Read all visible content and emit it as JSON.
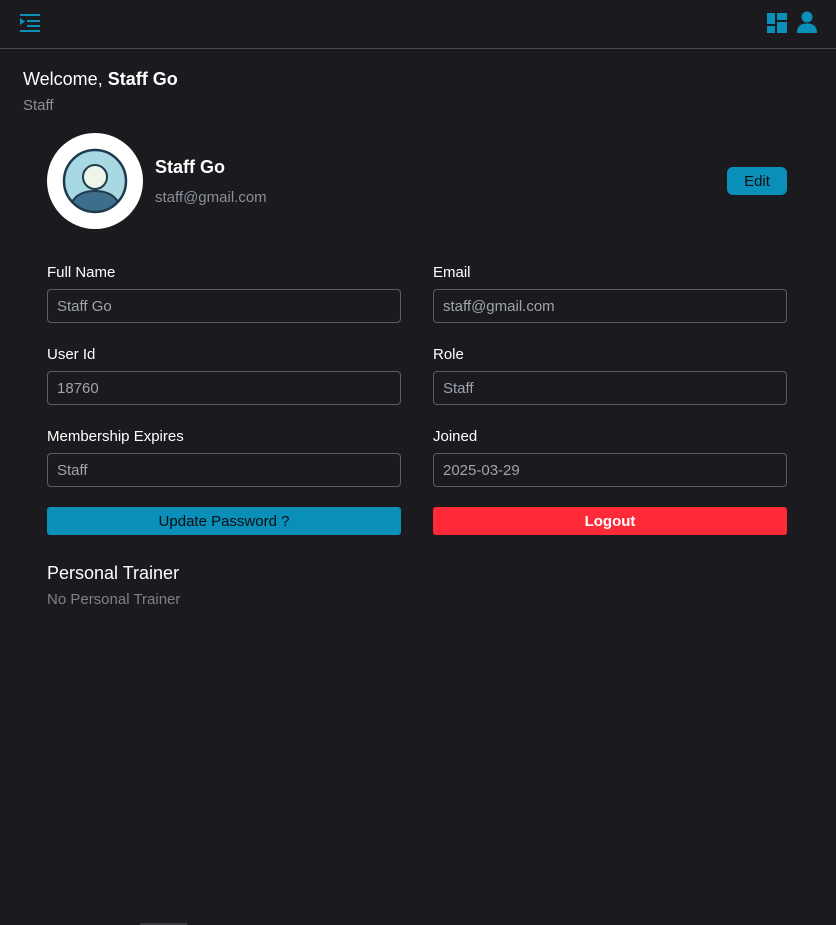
{
  "header": {
    "menu_icon": "menu-expand-icon",
    "dashboard_icon": "dashboard-icon",
    "user_icon": "user-icon",
    "accent_color": "#0a8fb8"
  },
  "welcome": {
    "prefix": "Welcome, ",
    "name": "Staff Go",
    "role": "Staff"
  },
  "profile": {
    "name": "Staff Go",
    "email": "staff@gmail.com",
    "edit_label": "Edit",
    "avatar_icon": "avatar-icon"
  },
  "form": {
    "full_name": {
      "label": "Full Name",
      "value": "Staff Go"
    },
    "email": {
      "label": "Email",
      "value": "staff@gmail.com"
    },
    "user_id": {
      "label": "User Id",
      "value": "18760"
    },
    "role": {
      "label": "Role",
      "value": "Staff"
    },
    "membership": {
      "label": "Membership Expires",
      "value": "Staff"
    },
    "joined": {
      "label": "Joined",
      "value": "2025-03-29"
    }
  },
  "actions": {
    "update_password_label": "Update Password ?",
    "logout_label": "Logout",
    "logout_color": "#fe2a38"
  },
  "trainer": {
    "title": "Personal Trainer",
    "value": "No Personal Trainer"
  }
}
